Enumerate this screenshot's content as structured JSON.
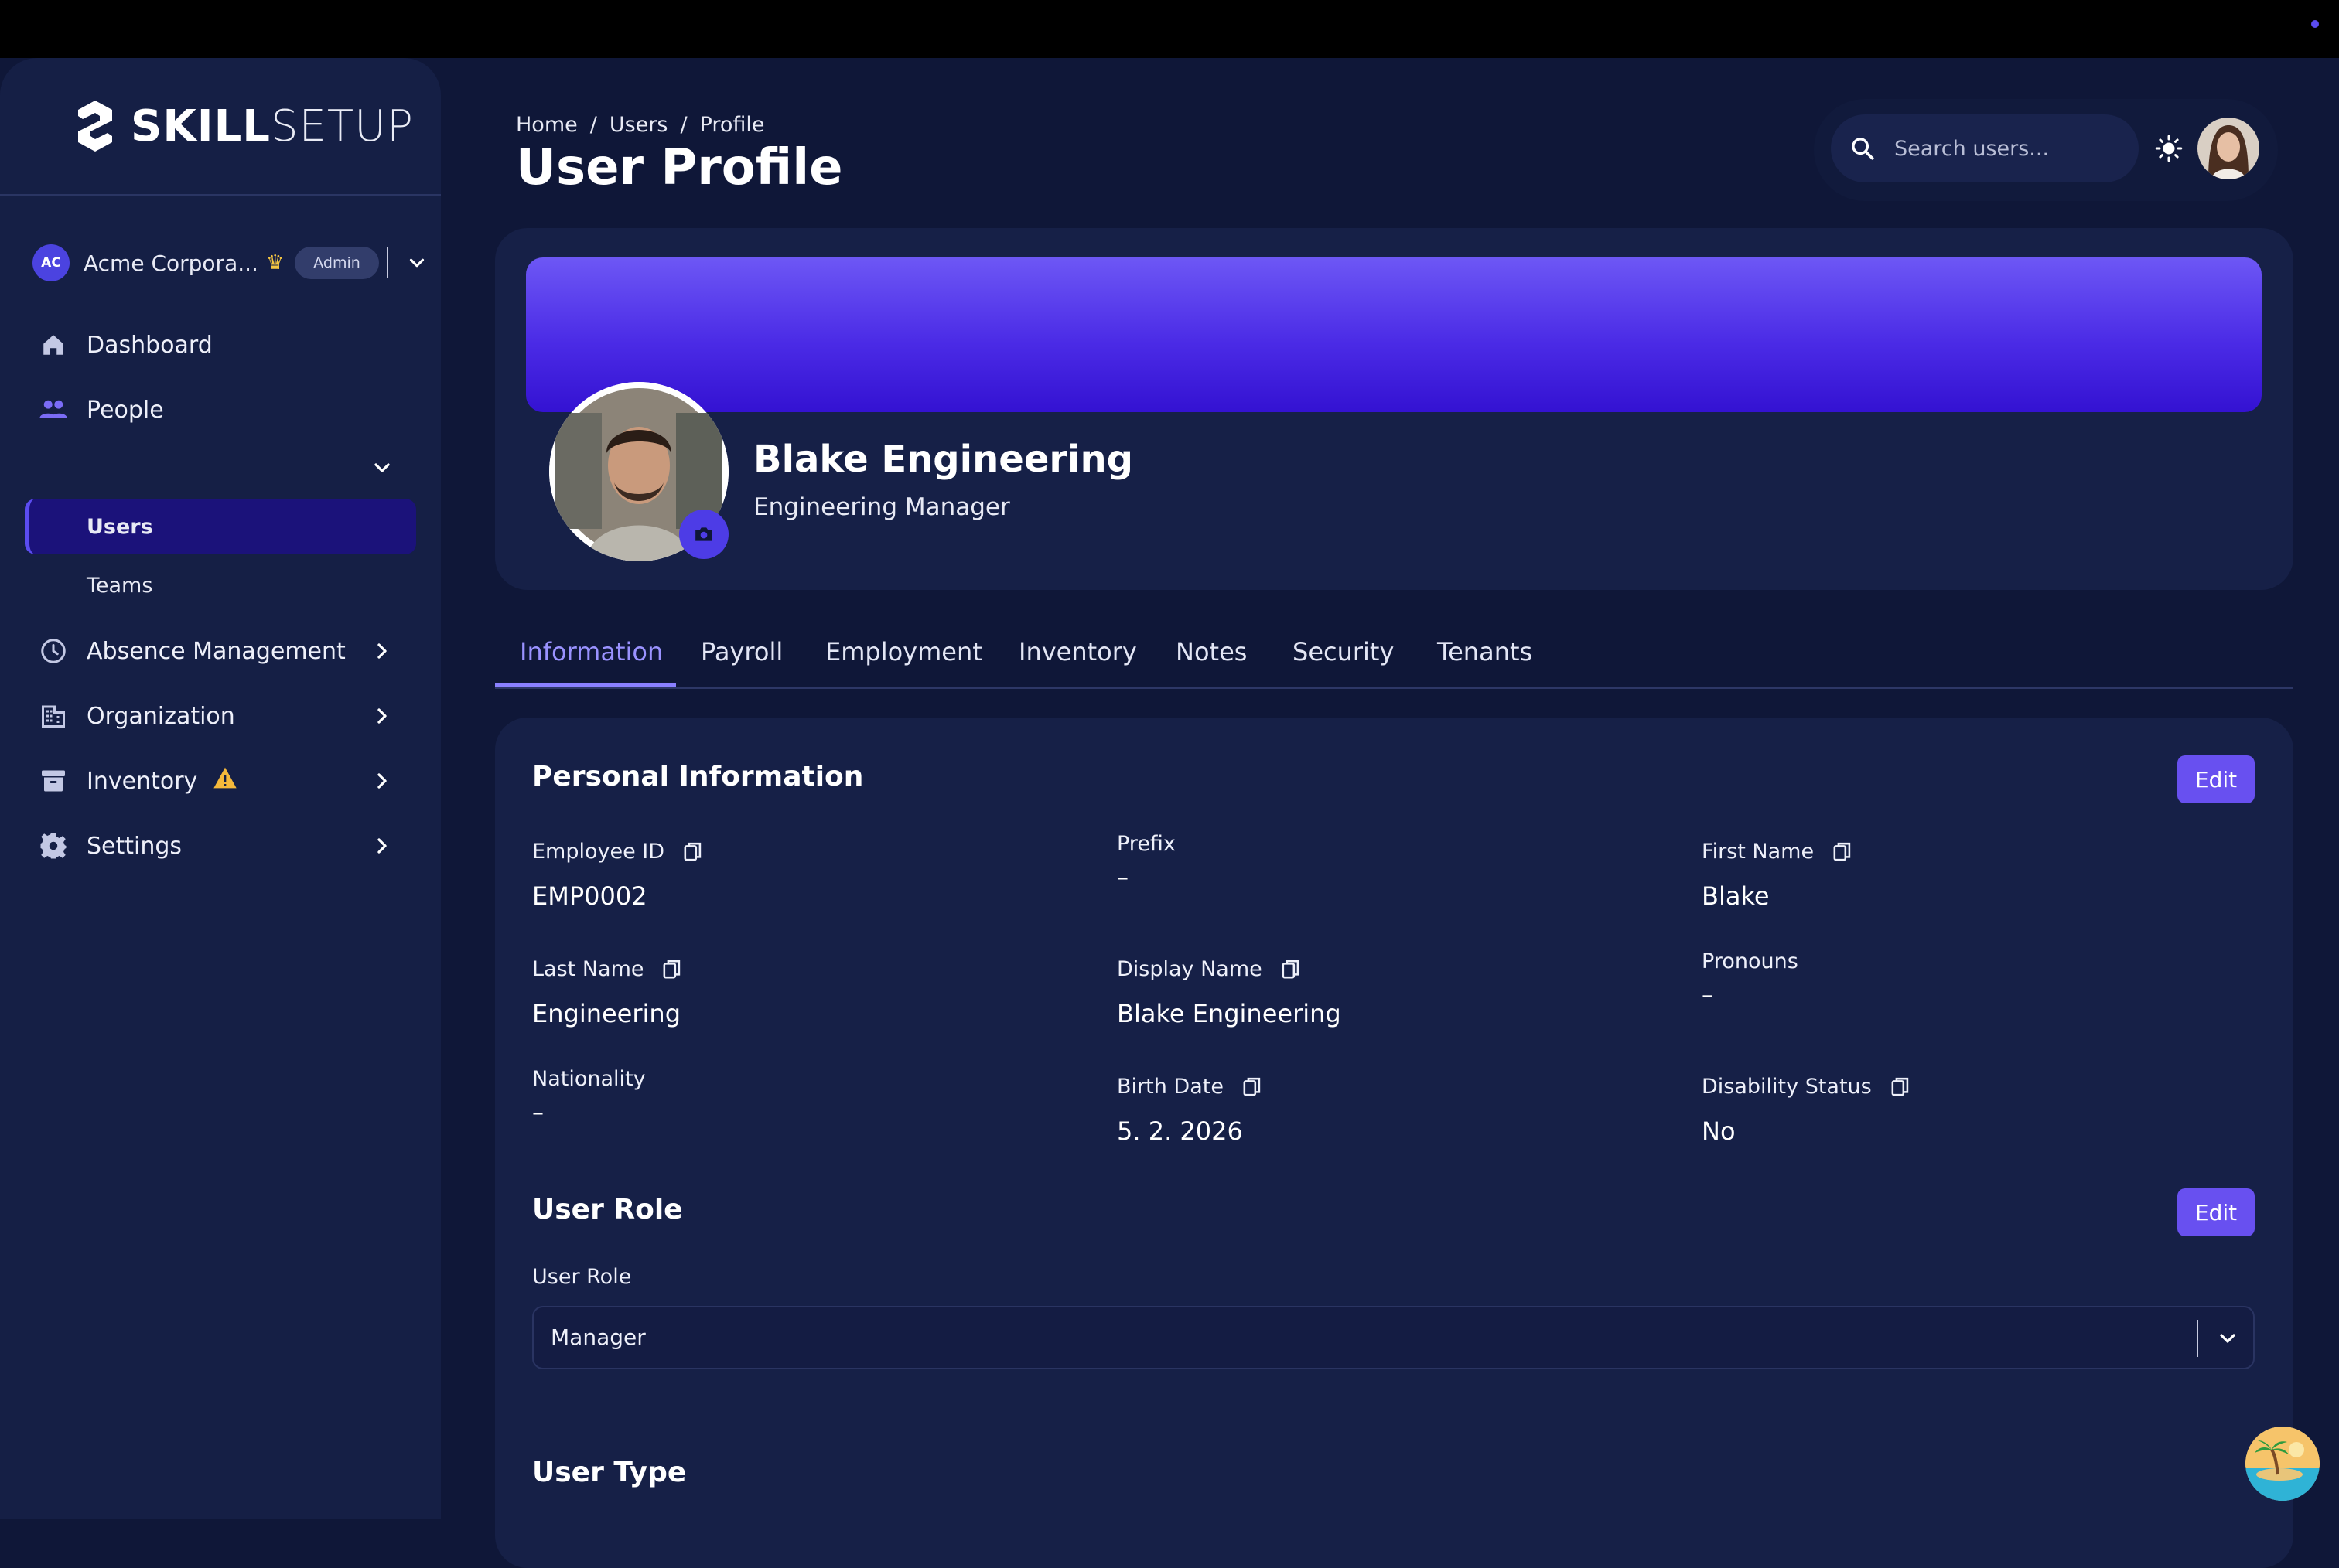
{
  "brand": {
    "name_bold": "SKILL",
    "name_light": "SETUP"
  },
  "org": {
    "initials": "AC",
    "name": "Acme Corpora...",
    "badge": "Admin"
  },
  "nav": {
    "dashboard": "Dashboard",
    "people": "People",
    "users": "Users",
    "teams": "Teams",
    "absence": "Absence Management",
    "organization": "Organization",
    "inventory": "Inventory",
    "settings": "Settings"
  },
  "breadcrumb": [
    "Home",
    "Users",
    "Profile"
  ],
  "page_title": "User Profile",
  "search": {
    "placeholder": "Search users..."
  },
  "profile": {
    "name": "Blake Engineering",
    "role": "Engineering Manager"
  },
  "tabs": [
    "Information",
    "Payroll",
    "Employment",
    "Inventory",
    "Notes",
    "Security",
    "Tenants"
  ],
  "active_tab": "Information",
  "personal": {
    "title": "Personal Information",
    "edit": "Edit",
    "fields": {
      "employee_id": {
        "label": "Employee ID",
        "value": "EMP0002"
      },
      "prefix": {
        "label": "Prefix",
        "value": "–"
      },
      "first_name": {
        "label": "First Name",
        "value": "Blake"
      },
      "last_name": {
        "label": "Last Name",
        "value": "Engineering"
      },
      "display_name": {
        "label": "Display Name",
        "value": "Blake Engineering"
      },
      "pronouns": {
        "label": "Pronouns",
        "value": "–"
      },
      "nationality": {
        "label": "Nationality",
        "value": "–"
      },
      "birth_date": {
        "label": "Birth Date",
        "value": "5. 2. 2026"
      },
      "disability": {
        "label": "Disability Status",
        "value": "No"
      }
    }
  },
  "user_role": {
    "title": "User Role",
    "edit": "Edit",
    "label": "User Role",
    "value": "Manager"
  },
  "user_type": {
    "title": "User Type"
  },
  "colors": {
    "accent": "#6850f0",
    "background": "#0f1738",
    "card": "#162047",
    "sidebar": "#151f45",
    "active_tab": "#9a92ff"
  }
}
